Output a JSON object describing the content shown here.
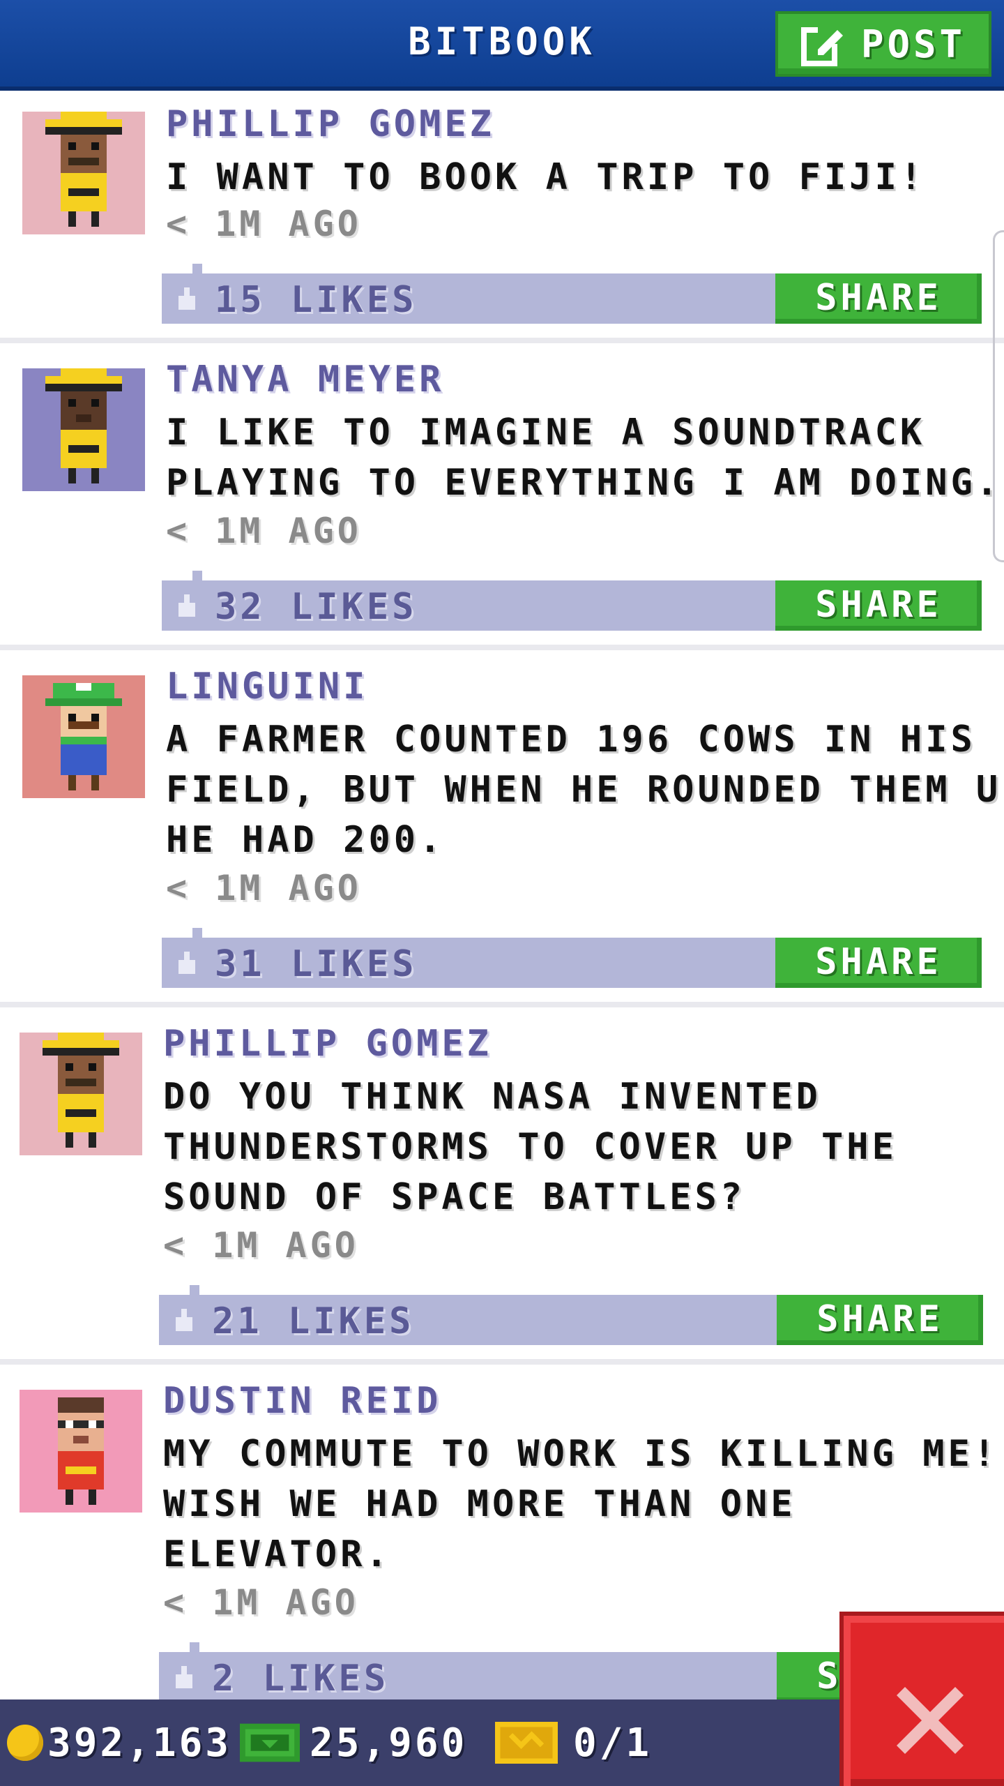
{
  "header": {
    "title": "BITBOOK",
    "post_label": "POST"
  },
  "share_label": "SHARE",
  "posts": [
    {
      "name": "PHILLIP GOMEZ",
      "lines": [
        "I WANT TO BOOK A TRIP TO FIJI!"
      ],
      "time": "< 1M AGO",
      "likes": "15 LIKES",
      "avatar": {
        "bg": "#e8b4bc",
        "skin": "#8a5a3c",
        "hat": "#f5d020",
        "shirt": "#f5d020",
        "accessory": "hat"
      }
    },
    {
      "name": "TANYA MEYER",
      "lines": [
        "I LIKE TO IMAGINE A SOUNDTRACK",
        "PLAYING TO EVERYTHING I AM DOING."
      ],
      "time": "< 1M AGO",
      "likes": "32 LIKES",
      "avatar": {
        "bg": "#8a85c2",
        "skin": "#5a3a28",
        "hat": "#f5d020",
        "shirt": "#f5d020",
        "accessory": "hat"
      }
    },
    {
      "name": "LINGUINI",
      "lines": [
        "A FARMER COUNTED 196 COWS IN HIS",
        "FIELD, BUT WHEN HE ROUNDED THEM UP",
        "HE HAD 200."
      ],
      "time": "< 1M AGO",
      "likes": "31 LIKES",
      "avatar": {
        "bg": "#e08a84",
        "skin": "#f0c8a0",
        "hat": "#3cb84a",
        "shirt": "#3a5cc8",
        "accessory": "cap"
      }
    },
    {
      "name": "PHILLIP GOMEZ",
      "lines": [
        "DO YOU THINK NASA INVENTED",
        "THUNDERSTORMS TO COVER UP THE",
        "SOUND OF SPACE BATTLES?"
      ],
      "time": "< 1M AGO",
      "likes": "21 LIKES",
      "avatar": {
        "bg": "#e8b4bc",
        "skin": "#8a5a3c",
        "hat": "#f5d020",
        "shirt": "#f5d020",
        "accessory": "hat"
      }
    },
    {
      "name": "DUSTIN REID",
      "lines": [
        "MY COMMUTE TO WORK IS KILLING ME! I",
        "WISH WE HAD MORE THAN ONE",
        "ELEVATOR."
      ],
      "time": "< 1M AGO",
      "likes": "2 LIKES",
      "avatar": {
        "bg": "#f29ab8",
        "skin": "#e8b090",
        "hat": "#2a2a2a",
        "shirt": "#e03a2a",
        "accessory": "mask"
      }
    }
  ],
  "bottom_bar": {
    "coins": "392,163",
    "bux": "25,960",
    "tickets": "0/1"
  },
  "colors": {
    "header": "#1c4fa8",
    "green": "#3fb33a",
    "likes_bar": "#b3b6d8",
    "bottom_bar": "#3b3f6a",
    "close": "#e0262a"
  },
  "icons": {
    "post": "edit-icon",
    "like": "thumb-up-icon",
    "coin": "coin-icon",
    "bux": "cash-icon",
    "ticket": "ticket-icon",
    "close": "close-icon"
  }
}
